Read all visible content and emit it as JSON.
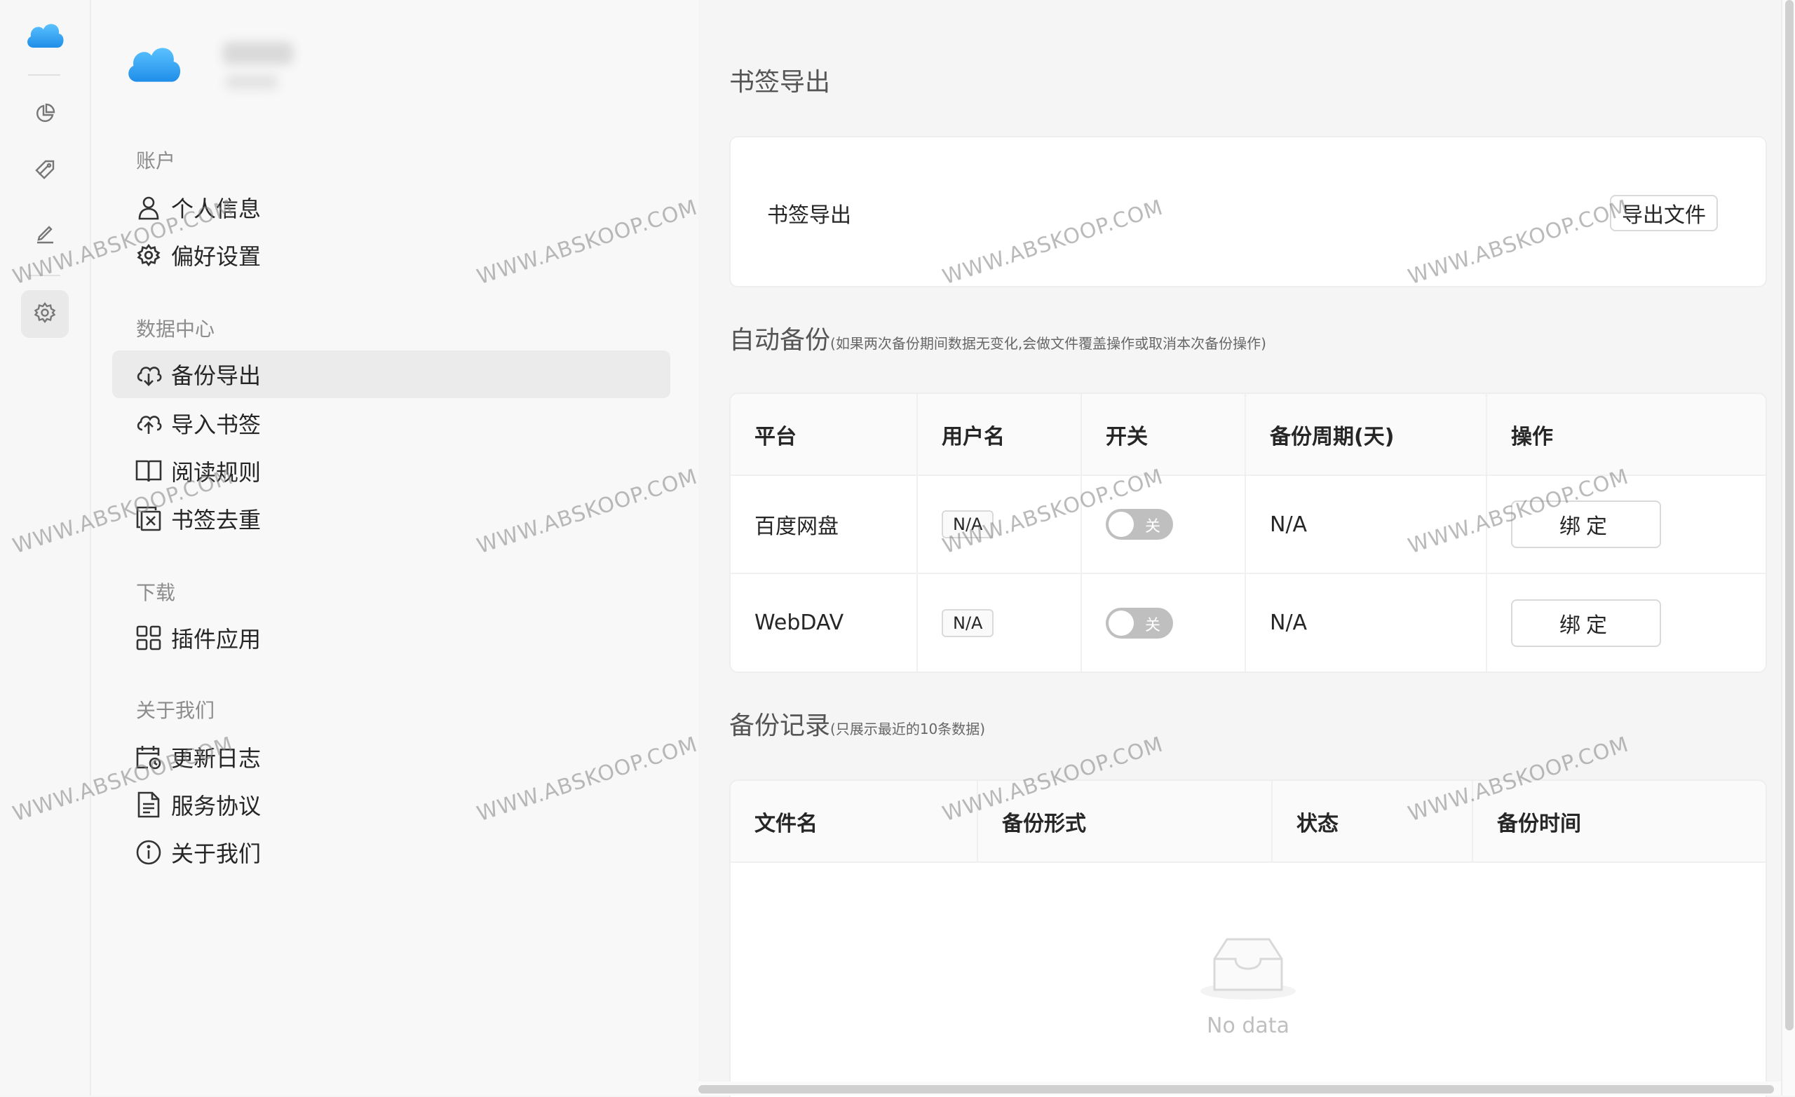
{
  "rail": {
    "items": [
      {
        "name": "dashboard",
        "icon": "pie-chart-icon"
      },
      {
        "name": "bookmarks",
        "icon": "tag-icon"
      },
      {
        "name": "edit",
        "icon": "pen-icon"
      },
      {
        "name": "settings",
        "icon": "gear-icon",
        "active": true
      }
    ]
  },
  "sidebar": {
    "sections": [
      {
        "title": "账户",
        "items": [
          {
            "label": "个人信息",
            "icon": "user-icon"
          },
          {
            "label": "偏好设置",
            "icon": "gear-icon"
          }
        ]
      },
      {
        "title": "数据中心",
        "items": [
          {
            "label": "备份导出",
            "icon": "cloud-download-icon",
            "active": true
          },
          {
            "label": "导入书签",
            "icon": "cloud-upload-icon"
          },
          {
            "label": "阅读规则",
            "icon": "book-icon"
          },
          {
            "label": "书签去重",
            "icon": "dedupe-icon"
          }
        ]
      },
      {
        "title": "下载",
        "items": [
          {
            "label": "插件应用",
            "icon": "apps-grid-icon"
          }
        ]
      },
      {
        "title": "关于我们",
        "items": [
          {
            "label": "更新日志",
            "icon": "calendar-clock-icon"
          },
          {
            "label": "服务协议",
            "icon": "document-icon"
          },
          {
            "label": "关于我们",
            "icon": "info-icon"
          }
        ]
      }
    ]
  },
  "main": {
    "title": "书签导出",
    "export": {
      "label": "书签导出",
      "button": "导出文件"
    },
    "auto_backup": {
      "title": "自动备份",
      "note": "(如果两次备份期间数据无变化,会做文件覆盖操作或取消本次备份操作)",
      "columns": [
        "平台",
        "用户名",
        "开关",
        "备份周期(天)",
        "操作"
      ],
      "rows": [
        {
          "platform": "百度网盘",
          "username": "N/A",
          "switch": "关",
          "period": "N/A",
          "action": "绑定"
        },
        {
          "platform": "WebDAV",
          "username": "N/A",
          "switch": "关",
          "period": "N/A",
          "action": "绑定"
        }
      ]
    },
    "records": {
      "title": "备份记录",
      "note": "(只展示最近的10条数据)",
      "columns": [
        "文件名",
        "备份形式",
        "状态",
        "备份时间"
      ],
      "empty_text": "No data"
    }
  },
  "watermark": "WWW.ABSKOOP.COM",
  "colors": {
    "accent_blue": "#3aa0f0",
    "switch_off": "#bfbfbf"
  }
}
